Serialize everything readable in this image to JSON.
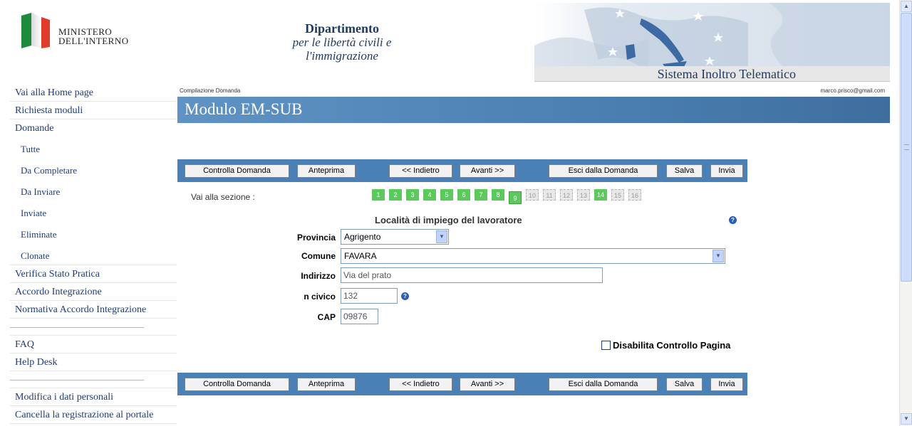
{
  "header": {
    "ministry_line1": "MINISTERO",
    "ministry_line2": "DELL'INTERNO",
    "dept_line1": "Dipartimento",
    "dept_line2": "per le libertà civili e",
    "dept_line3": "l'immigrazione",
    "system_title": "Sistema Inoltro Telematico"
  },
  "sidebar": {
    "items": [
      "Vai alla Home page",
      "Richiesta moduli",
      "Domande"
    ],
    "sub_items": [
      "Tutte",
      "Da Completare",
      "Da Inviare",
      "Inviate",
      "Eliminate",
      "Clonate"
    ],
    "items2": [
      "Verifica Stato Pratica",
      "Accordo Integrazione",
      "Normativa Accordo Integrazione"
    ],
    "items3": [
      "FAQ",
      "Help Desk"
    ],
    "items4": [
      "Modifica i dati personali",
      "Cancella la registrazione al portale"
    ]
  },
  "page": {
    "breadcrumb": "Compilazione Domanda",
    "user_email": "marco.prisco@gmail.com",
    "title": "Modulo EM-SUB"
  },
  "toolbar": {
    "controlla": "Controlla Domanda",
    "anteprima": "Anteprima",
    "indietro": "<< Indietro",
    "avanti": "Avanti >>",
    "esci": "Esci dalla Domanda",
    "salva": "Salva",
    "invia": "Invia"
  },
  "sections": {
    "label": "Vai alla sezione :",
    "steps": [
      {
        "n": "1",
        "state": "done"
      },
      {
        "n": "2",
        "state": "done"
      },
      {
        "n": "3",
        "state": "done"
      },
      {
        "n": "4",
        "state": "done"
      },
      {
        "n": "5",
        "state": "done"
      },
      {
        "n": "6",
        "state": "done"
      },
      {
        "n": "7",
        "state": "done"
      },
      {
        "n": "8",
        "state": "done"
      },
      {
        "n": "9",
        "state": "current"
      },
      {
        "n": "10",
        "state": "todo"
      },
      {
        "n": "11",
        "state": "todo"
      },
      {
        "n": "12",
        "state": "todo"
      },
      {
        "n": "13",
        "state": "todo"
      },
      {
        "n": "14",
        "state": "done"
      },
      {
        "n": "15",
        "state": "todo"
      },
      {
        "n": "16",
        "state": "todo"
      }
    ]
  },
  "form": {
    "title": "Località di impiego del lavoratore",
    "provincia_label": "Provincia",
    "provincia_value": "Agrigento",
    "comune_label": "Comune",
    "comune_value": "FAVARA",
    "indirizzo_label": "Indirizzo",
    "indirizzo_value": "Via del prato",
    "civico_label": "n civico",
    "civico_value": "132",
    "cap_label": "CAP",
    "cap_value": "09876",
    "checkbox_label": "Disabilita Controllo Pagina",
    "checkbox_checked": false
  },
  "icons": {
    "help": "help-question-icon",
    "dropdown": "chevron-down-icon"
  },
  "colors": {
    "accent_blue": "#4a80b6",
    "step_done": "#5bc95b",
    "link": "#1e3c78"
  }
}
